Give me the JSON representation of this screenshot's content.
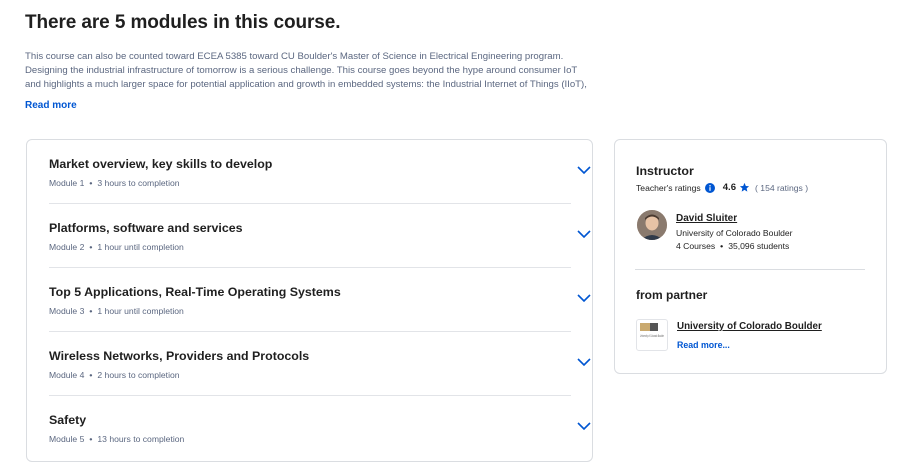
{
  "heading": "There are 5 modules in this course.",
  "description": "This course can also be counted toward ECEA 5385 toward CU Boulder's Master of Science in Electrical Engineering program. Designing the industrial infrastructure of tomorrow is a serious challenge. This course goes beyond the hype around consumer IoT and highlights a much larger space for potential application and growth in embedded systems: the Industrial Internet of Things (IIoT), also known as",
  "read_more_label": "Read more",
  "modules": [
    {
      "title": "Market overview, key skills to develop",
      "module": "Module 1",
      "duration": "3 hours to completion"
    },
    {
      "title": "Platforms, software and services",
      "module": "Module 2",
      "duration": "1 hour until completion"
    },
    {
      "title": "Top 5 Applications, Real-Time Operating Systems",
      "module": "Module 3",
      "duration": "1 hour until completion"
    },
    {
      "title": "Wireless Networks, Providers and Protocols",
      "module": "Module 4",
      "duration": "2 hours to completion"
    },
    {
      "title": "Safety",
      "module": "Module 5",
      "duration": "13 hours to completion"
    }
  ],
  "meta_separator": "•",
  "instructor": {
    "section_title": "Instructor",
    "ratings_label": "Teacher's ratings",
    "rating": "4.6",
    "rating_count": "( 154 ratings )",
    "name": "David Sluiter",
    "org": "University of Colorado Boulder",
    "courses": "4 Courses",
    "students": "35,096 students"
  },
  "partner": {
    "section_title": "from partner",
    "logo_text": "University of Colorado Boulder",
    "name": "University of Colorado Boulder",
    "read_more_label": "Read more..."
  },
  "colors": {
    "accent": "#0056d2",
    "muted_text": "#5b6780",
    "border": "#dadde1"
  },
  "icons": [
    "chevron-down-icon",
    "info-icon",
    "star-icon",
    "avatar",
    "cu-logo-icon"
  ]
}
